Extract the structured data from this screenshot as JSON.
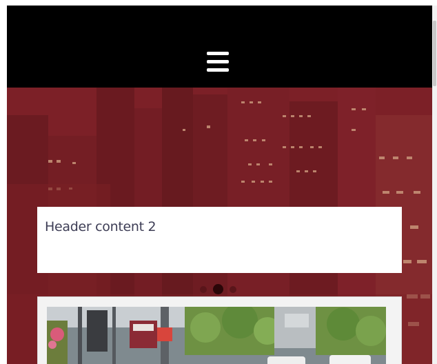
{
  "nav": {
    "menu_icon": "hamburger-menu-icon"
  },
  "hero": {
    "background": "city-skyline-red-tint",
    "overlay_color": "#7a1f25"
  },
  "header_card": {
    "text": "Header content 2"
  },
  "carousel": {
    "slide_count": 3,
    "active_index": 1
  },
  "photo_card": {
    "image": "street-scene-photo"
  }
}
